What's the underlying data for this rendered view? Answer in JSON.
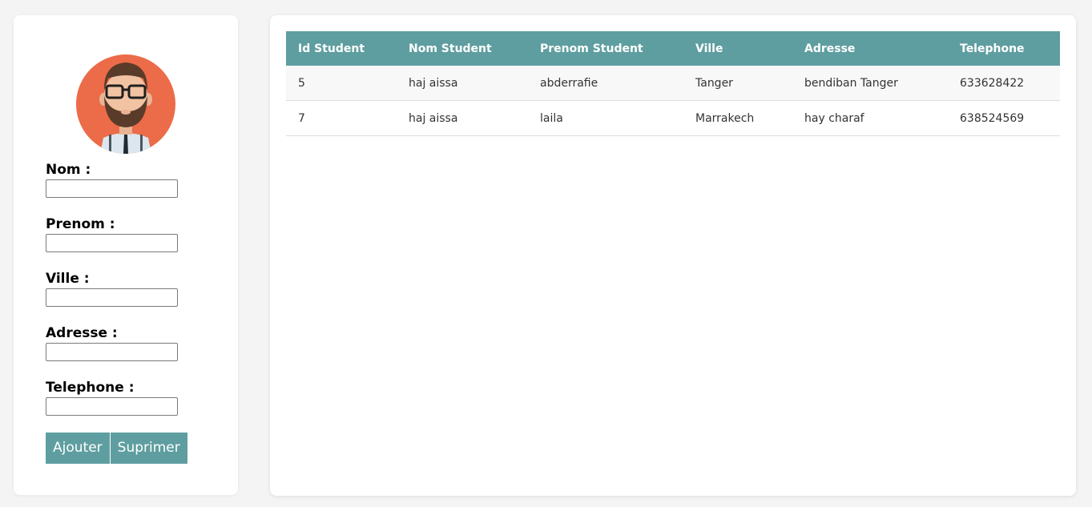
{
  "form": {
    "fields": [
      {
        "label": "Nom :",
        "value": ""
      },
      {
        "label": "Prenom :",
        "value": ""
      },
      {
        "label": "Ville :",
        "value": ""
      },
      {
        "label": "Adresse :",
        "value": ""
      },
      {
        "label": "Telephone :",
        "value": ""
      }
    ],
    "buttons": {
      "add_label": "Ajouter",
      "delete_label": "Suprimer"
    }
  },
  "table": {
    "headers": [
      "Id Student",
      "Nom Student",
      "Prenom Student",
      "Ville",
      "Adresse",
      "Telephone"
    ],
    "rows": [
      [
        "5",
        "haj aissa",
        "abderrafie",
        "Tanger",
        "bendiban Tanger",
        "633628422"
      ],
      [
        "7",
        "haj aissa",
        "laila",
        "Marrakech",
        "hay charaf",
        "638524569"
      ]
    ]
  },
  "colors": {
    "accent": "#5f9ea0",
    "avatar_bg": "#ec6b48"
  },
  "icons": {
    "avatar": "bearded-man-glasses-avatar"
  }
}
